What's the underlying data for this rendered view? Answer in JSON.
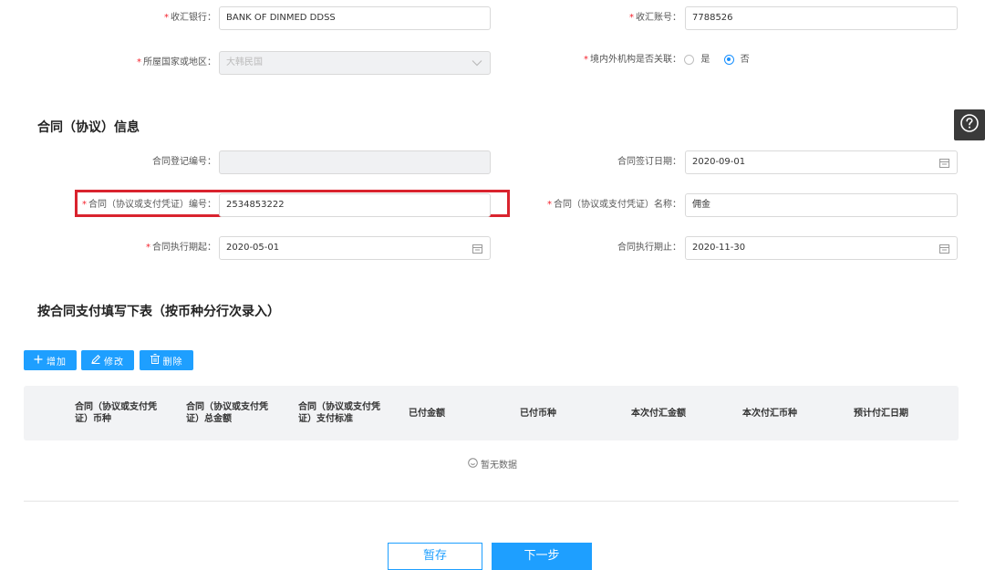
{
  "payee": {
    "bank_label": "收汇银行：",
    "bank_value": "BANK OF DINMED DDSS",
    "account_label": "收汇账号：",
    "account_value": "7788526",
    "country_label": "所屋国家或地区：",
    "country_placeholder": "大韩民国",
    "related_label": "境内外机构是否关联：",
    "related_options": [
      {
        "label": "是",
        "selected": false
      },
      {
        "label": "否",
        "selected": true
      }
    ]
  },
  "contract": {
    "title": "合同（协议）信息",
    "reg_no_label": "合同登记编号：",
    "reg_no_value": "",
    "sign_date_label": "合同签订日期：",
    "sign_date_value": "2020-09-01",
    "contract_no_label": "合同（协议或支付凭证）编号：",
    "contract_no_value": "2534853222",
    "contract_name_label": "合同（协议或支付凭证）名称：",
    "contract_name_value": "佣金",
    "start_label": "合同执行期起：",
    "start_value": "2020-05-01",
    "end_label": "合同执行期止：",
    "end_value": "2020-11-30"
  },
  "payment_table": {
    "title": "按合同支付填写下表（按币种分行次录入）",
    "add_label": "增加",
    "edit_label": "修改",
    "delete_label": "删除",
    "columns": [
      [
        "合同（协议或支付凭",
        "证）币种"
      ],
      [
        "合同（协议或支付凭",
        "证）总金额"
      ],
      [
        "合同（协议或支付凭",
        "证）支付标准"
      ],
      [
        "已付金额"
      ],
      [
        "已付币种"
      ],
      [
        "本次付汇金额"
      ],
      [
        "本次付汇币种"
      ],
      [
        "预计付汇日期"
      ]
    ],
    "empty_text": "暂无数据"
  },
  "footer": {
    "save_label": "暂存",
    "next_label": "下一步"
  },
  "colors": {
    "primary": "#1e9fff",
    "required": "#f5222d",
    "highlight": "#d9232e"
  },
  "icons": {
    "help": "help-circle-icon",
    "calendar": "calendar-icon",
    "dropdown": "chevron-down-icon",
    "add": "plus-icon",
    "edit": "pencil-icon",
    "delete": "trash-icon",
    "empty": "smile-icon"
  }
}
